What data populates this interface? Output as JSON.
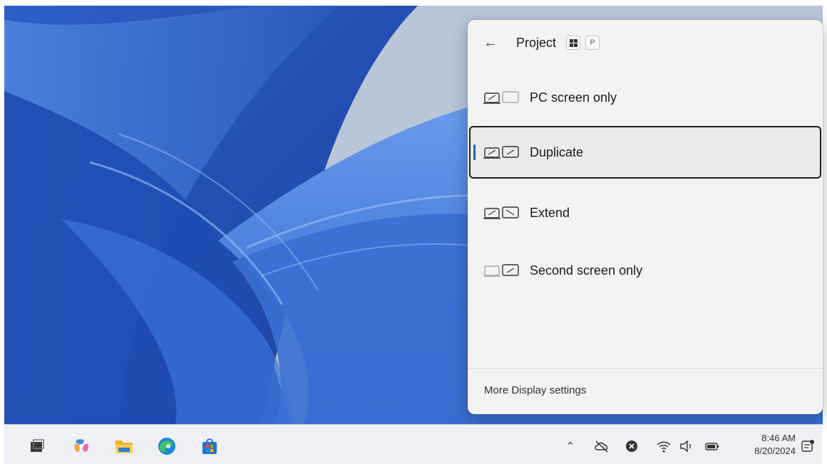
{
  "flyout": {
    "back_icon": "arrow-left-icon",
    "title": "Project",
    "shortcut_key": "P",
    "options": [
      {
        "label": "PC screen only",
        "icon": "pc-screen-only-icon",
        "selected": false
      },
      {
        "label": "Duplicate",
        "icon": "duplicate-icon",
        "selected": true
      },
      {
        "label": "Extend",
        "icon": "extend-icon",
        "selected": false
      },
      {
        "label": "Second screen only",
        "icon": "second-screen-only-icon",
        "selected": false
      }
    ],
    "more_settings": "More Display settings",
    "accent_color": "#0067c0"
  },
  "taskbar": {
    "apps": [
      "task-view-icon",
      "copilot-icon",
      "file-explorer-icon",
      "edge-icon",
      "store-icon"
    ],
    "tray": [
      "chevron-up-icon",
      "onedrive-offline-icon",
      "error-icon",
      "wifi-icon",
      "volume-icon",
      "battery-icon"
    ],
    "clock_time": "8:46 AM",
    "clock_date": "8/20/2024"
  }
}
